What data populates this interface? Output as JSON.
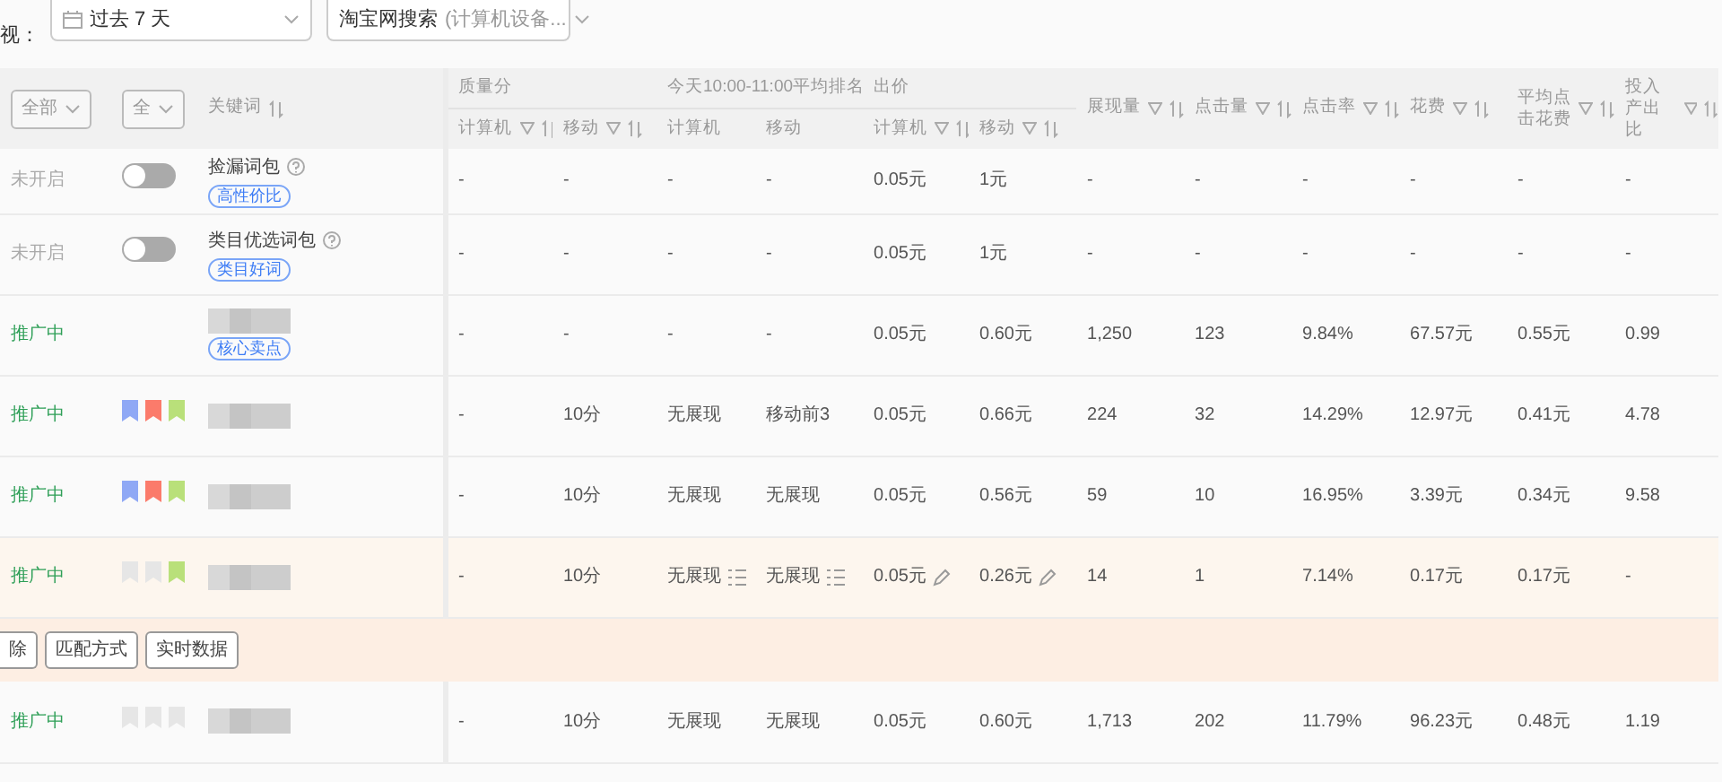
{
  "filter_bar": {
    "label": "视：",
    "filters": [
      {
        "kind": "date",
        "value": "过去 7 天"
      },
      {
        "kind": "channel",
        "value": "淘宝网搜索",
        "hint": "(计算机设备..."
      }
    ]
  },
  "table": {
    "status_filter": "全部",
    "flag_filter": "全",
    "keyword_header": {
      "label": "关键词",
      "sort": true
    },
    "groups": [
      {
        "label": "质量分",
        "columns": [
          {
            "label": "计算机",
            "filter": true,
            "sort": true
          },
          {
            "label": "移动",
            "filter": true,
            "sort": true
          }
        ]
      },
      {
        "label": "今天10:00-11:00平均排名",
        "columns": [
          {
            "label": "计算机",
            "filter": false,
            "sort": false
          },
          {
            "label": "移动",
            "filter": false,
            "sort": false
          }
        ]
      },
      {
        "label": "出价",
        "columns": [
          {
            "label": "计算机",
            "filter": true,
            "sort": true
          },
          {
            "label": "移动",
            "filter": true,
            "sort": true
          }
        ]
      }
    ],
    "metric_columns": [
      {
        "label": "展现量",
        "filter": true,
        "sort": true
      },
      {
        "label": "点击量",
        "filter": true,
        "sort": true
      },
      {
        "label": "点击率",
        "filter": true,
        "sort": true
      },
      {
        "label": "花费",
        "filter": true,
        "sort": true
      },
      {
        "label": "平均点击花费",
        "filter": true,
        "sort": true
      },
      {
        "label": "投入产出比",
        "filter": true,
        "sort": true
      }
    ],
    "rows": [
      {
        "kind": "keyword",
        "status": {
          "text": "未开启",
          "kind": "paused"
        },
        "control": {
          "kind": "toggle",
          "on": false
        },
        "keyword": {
          "kind": "named",
          "text": "捡漏词包",
          "help": true,
          "tag": "高性价比"
        },
        "highlighted": false,
        "cells": [
          {
            "text": "-"
          },
          {
            "text": "-"
          },
          {
            "text": "-"
          },
          {
            "text": "-"
          },
          {
            "text": "0.05元"
          },
          {
            "text": "1元"
          },
          {
            "text": "-"
          },
          {
            "text": "-"
          },
          {
            "text": "-"
          },
          {
            "text": "-"
          },
          {
            "text": "-"
          },
          {
            "text": "-"
          }
        ]
      },
      {
        "kind": "keyword",
        "status": {
          "text": "未开启",
          "kind": "paused"
        },
        "control": {
          "kind": "toggle",
          "on": false
        },
        "keyword": {
          "kind": "named",
          "text": "类目优选词包",
          "help": true,
          "tag": "类目好词"
        },
        "highlighted": false,
        "cells": [
          {
            "text": "-"
          },
          {
            "text": "-"
          },
          {
            "text": "-"
          },
          {
            "text": "-"
          },
          {
            "text": "0.05元"
          },
          {
            "text": "1元"
          },
          {
            "text": "-"
          },
          {
            "text": "-"
          },
          {
            "text": "-"
          },
          {
            "text": "-"
          },
          {
            "text": "-"
          },
          {
            "text": "-"
          }
        ]
      },
      {
        "kind": "keyword",
        "status": {
          "text": "推广中",
          "kind": "active"
        },
        "control": {
          "kind": "none"
        },
        "keyword": {
          "kind": "redacted",
          "tag": "核心卖点"
        },
        "highlighted": false,
        "cells": [
          {
            "text": "-"
          },
          {
            "text": "-"
          },
          {
            "text": "-"
          },
          {
            "text": "-"
          },
          {
            "text": "0.05元"
          },
          {
            "text": "0.60元"
          },
          {
            "text": "1,250"
          },
          {
            "text": "123"
          },
          {
            "text": "9.84%"
          },
          {
            "text": "67.57元"
          },
          {
            "text": "0.55元"
          },
          {
            "text": "0.99"
          }
        ]
      },
      {
        "kind": "keyword",
        "status": {
          "text": "推广中",
          "kind": "active"
        },
        "control": {
          "kind": "flags",
          "flags": [
            {
              "color": "#8fa8f5"
            },
            {
              "color": "#fb7b6b"
            },
            {
              "color": "#b9e07a"
            }
          ]
        },
        "keyword": {
          "kind": "redacted"
        },
        "highlighted": false,
        "cells": [
          {
            "text": "-"
          },
          {
            "text": "10分"
          },
          {
            "text": "无展现"
          },
          {
            "text": "移动前3"
          },
          {
            "text": "0.05元"
          },
          {
            "text": "0.66元"
          },
          {
            "text": "224"
          },
          {
            "text": "32"
          },
          {
            "text": "14.29%"
          },
          {
            "text": "12.97元"
          },
          {
            "text": "0.41元"
          },
          {
            "text": "4.78"
          }
        ]
      },
      {
        "kind": "keyword",
        "status": {
          "text": "推广中",
          "kind": "active"
        },
        "control": {
          "kind": "flags",
          "flags": [
            {
              "color": "#8fa8f5"
            },
            {
              "color": "#fb7b6b"
            },
            {
              "color": "#b9e07a"
            }
          ]
        },
        "keyword": {
          "kind": "redacted"
        },
        "highlighted": false,
        "cells": [
          {
            "text": "-"
          },
          {
            "text": "10分"
          },
          {
            "text": "无展现"
          },
          {
            "text": "无展现"
          },
          {
            "text": "0.05元"
          },
          {
            "text": "0.56元"
          },
          {
            "text": "59"
          },
          {
            "text": "10"
          },
          {
            "text": "16.95%"
          },
          {
            "text": "3.39元"
          },
          {
            "text": "0.34元"
          },
          {
            "text": "9.58"
          }
        ]
      },
      {
        "kind": "keyword",
        "status": {
          "text": "推广中",
          "kind": "active"
        },
        "control": {
          "kind": "flags",
          "flags": [
            {
              "color": "#e6e6e6"
            },
            {
              "color": "#e6e6e6"
            },
            {
              "color": "#b9e07a"
            }
          ]
        },
        "keyword": {
          "kind": "redacted"
        },
        "highlighted": true,
        "cells": [
          {
            "text": "-"
          },
          {
            "text": "10分"
          },
          {
            "text": "无展现",
            "kind": "detail"
          },
          {
            "text": "无展现",
            "kind": "detail"
          },
          {
            "text": "0.05元",
            "kind": "editable"
          },
          {
            "text": "0.26元",
            "kind": "editable"
          },
          {
            "text": "14"
          },
          {
            "text": "1"
          },
          {
            "text": "7.14%"
          },
          {
            "text": "0.17元"
          },
          {
            "text": "0.17元"
          },
          {
            "text": "-"
          }
        ]
      },
      {
        "kind": "actions",
        "buttons": [
          "除",
          "匹配方式",
          "实时数据"
        ]
      },
      {
        "kind": "keyword",
        "status": {
          "text": "推广中",
          "kind": "active"
        },
        "control": {
          "kind": "flags",
          "flags": [
            {
              "color": "#e6e6e6"
            },
            {
              "color": "#e6e6e6"
            },
            {
              "color": "#e6e6e6"
            }
          ]
        },
        "keyword": {
          "kind": "redacted"
        },
        "highlighted": false,
        "cells": [
          {
            "text": "-"
          },
          {
            "text": "10分"
          },
          {
            "text": "无展现"
          },
          {
            "text": "无展现"
          },
          {
            "text": "0.05元"
          },
          {
            "text": "0.60元"
          },
          {
            "text": "1,713"
          },
          {
            "text": "202"
          },
          {
            "text": "11.79%"
          },
          {
            "text": "96.23元"
          },
          {
            "text": "0.48元"
          },
          {
            "text": "1.19"
          }
        ]
      }
    ]
  }
}
